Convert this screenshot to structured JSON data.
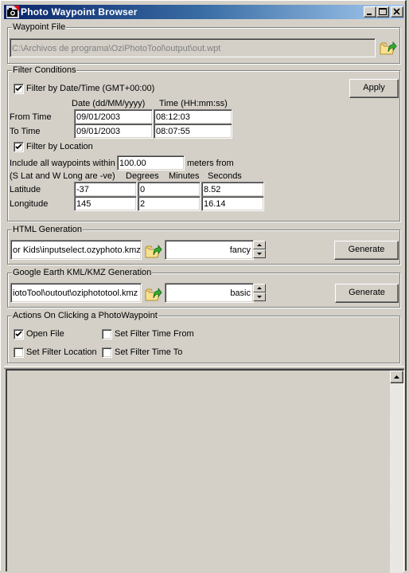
{
  "window": {
    "title": "Photo Waypoint Browser",
    "controls": {
      "minimize": "_",
      "maximize": "□",
      "close": "✕"
    }
  },
  "waypoint_file": {
    "group_label": "Waypoint File",
    "path": "C:\\Archivos de programa\\OziPhotoTool\\output\\out.wpt",
    "browse_icon": "folder-open-icon"
  },
  "filter": {
    "group_label": "Filter Conditions",
    "by_datetime": {
      "label": "Filter by Date/Time (GMT+00:00)",
      "checked": true
    },
    "apply_label": "Apply",
    "date_header": "Date (dd/MM/yyyy)",
    "time_header": "Time (HH:mm:ss)",
    "from": {
      "label": "From Time",
      "date": "09/01/2003",
      "time": "08:12:03"
    },
    "to": {
      "label": "To Time",
      "date": "09/01/2003",
      "time": "08:07:55"
    },
    "by_location": {
      "label": "Filter by Location",
      "checked": true
    },
    "within_prefix": "Include all waypoints within",
    "within_value": "100.00",
    "within_suffix": "meters from",
    "sign_note": "(S Lat and W Long are -ve)",
    "degrees_header": "Degrees",
    "minutes_header": "Minutes",
    "seconds_header": "Seconds",
    "latitude": {
      "label": "Latitude",
      "degrees": "-37",
      "minutes": "0",
      "seconds": "8.52"
    },
    "longitude": {
      "label": "Longitude",
      "degrees": "145",
      "minutes": "2",
      "seconds": "16.14"
    }
  },
  "html_gen": {
    "group_label": "HTML Generation",
    "path": "or Kids\\inputselect.ozyphoto.kmz",
    "style": "fancy",
    "generate_label": "Generate"
  },
  "kml_gen": {
    "group_label": "Google Earth KML/KMZ Generation",
    "path": "iotoTool\\outout\\oziphototool.kmz",
    "style": "basic",
    "generate_label": "Generate"
  },
  "actions": {
    "group_label": "Actions On Clicking a PhotoWaypoint",
    "open_file": {
      "label": "Open File",
      "checked": true
    },
    "set_filter_time_from": {
      "label": "Set Filter Time From",
      "checked": false
    },
    "set_filter_location": {
      "label": "Set Filter Location",
      "checked": false
    },
    "set_filter_time_to": {
      "label": "Set Filter Time To",
      "checked": false
    }
  },
  "colors": {
    "face": "#d4d0c8",
    "title_start": "#0a246a",
    "title_end": "#a6caf0"
  }
}
